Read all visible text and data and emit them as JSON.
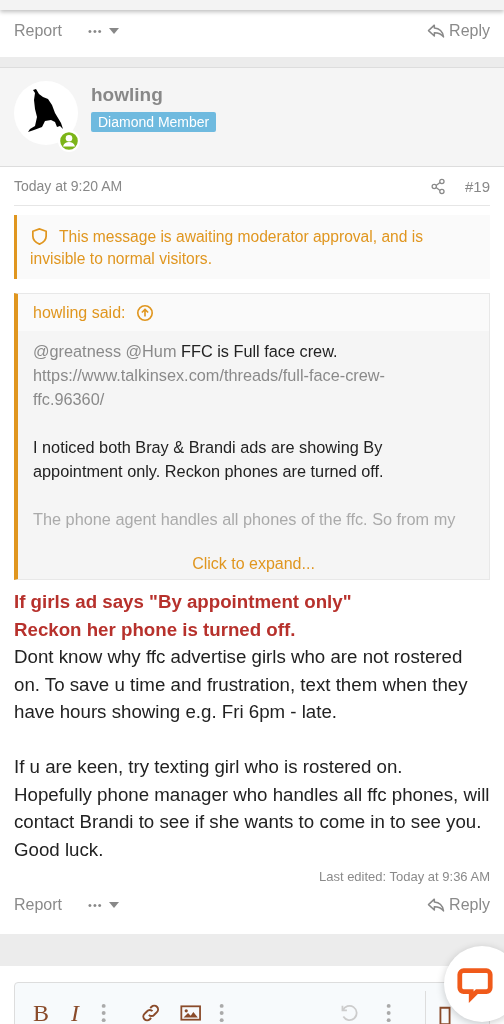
{
  "prev_post_actions": {
    "report": "Report",
    "more": "•••",
    "reply": "Reply"
  },
  "post": {
    "author": {
      "name": "howling",
      "badge": "Diamond Member",
      "online": true
    },
    "time": "Today at 9:20 AM",
    "number": "#19",
    "moderation_notice": "This message is awaiting moderator approval, and is invisible to normal visitors.",
    "quote": {
      "title": "howling said:",
      "paragraphs": [
        {
          "parts": [
            {
              "kind": "mention",
              "text": "@greatness"
            },
            {
              "kind": "mention",
              "text": "@Hum"
            },
            {
              "kind": "text",
              "text": "FFC is Full face crew."
            },
            {
              "kind": "link",
              "text": "https://www.talkinsex.com/threads/full-face-crew-ffc.96360/"
            }
          ]
        },
        {
          "parts": [
            {
              "kind": "text",
              "text": "I noticed both Bray & Brandi ads are showing By appointment only. Reckon phones are turned off."
            }
          ]
        },
        {
          "parts": [
            {
              "kind": "faded",
              "text": "The phone agent handles all phones of the ffc. So from my"
            }
          ]
        }
      ],
      "expand": "Click to expand..."
    },
    "body": [
      {
        "kind": "highlight",
        "text": "If girls ad says \"By appointment only\""
      },
      {
        "kind": "highlight",
        "text": "Reckon her phone is turned off."
      },
      {
        "kind": "plain",
        "text": "Dont know why ffc advertise girls who are not rostered on. To save u time and frustration, text them when they have hours showing e.g. Fri 6pm - late."
      },
      {
        "kind": "gap",
        "text": "If u are keen, try texting girl who is rostered on.\nHopefully phone manager who handles all ffc phones, will contact Brandi to see if she wants to come in to see you. Good luck."
      }
    ],
    "last_edited": "Last edited: Today at 9:36 AM",
    "actions": {
      "report": "Report",
      "more": "•••",
      "reply": "Reply"
    }
  },
  "editor": {
    "toolbar": [
      {
        "kind": "bold",
        "label": "B"
      },
      {
        "kind": "italic",
        "label": "I"
      },
      {
        "kind": "more"
      },
      {
        "kind": "link"
      },
      {
        "kind": "image"
      },
      {
        "kind": "more"
      },
      {
        "kind": "undo",
        "disabled": true
      },
      {
        "kind": "more"
      }
    ]
  }
}
